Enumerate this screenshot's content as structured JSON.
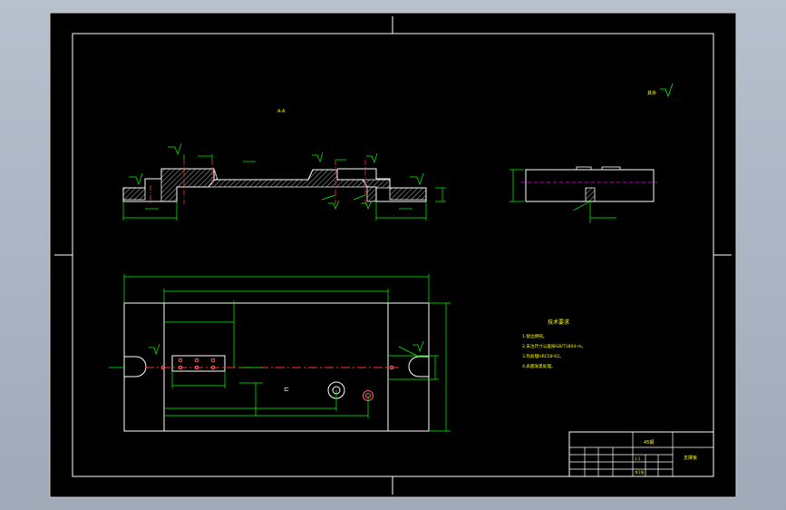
{
  "drawing": {
    "section_label": "A-A",
    "roughness_note": "其余",
    "tech_requirements": {
      "title": "技术要求",
      "items": [
        "1.锐边倒钝。",
        "2.未注尺寸公差按GB/T1804-m。",
        "3.热处理HRC58-62。",
        "4.表面发黑处理。"
      ]
    },
    "title_block": {
      "material": "45钢",
      "part_name": "支撑板",
      "scale": "1:1",
      "sheet": "共1张"
    }
  },
  "colors": {
    "background": "#000000",
    "frame": "#ffffff",
    "dimension": "#00ff00",
    "centerline": "#ff3030",
    "text_yellow": "#ffff00",
    "hatch": "#ffffff"
  }
}
